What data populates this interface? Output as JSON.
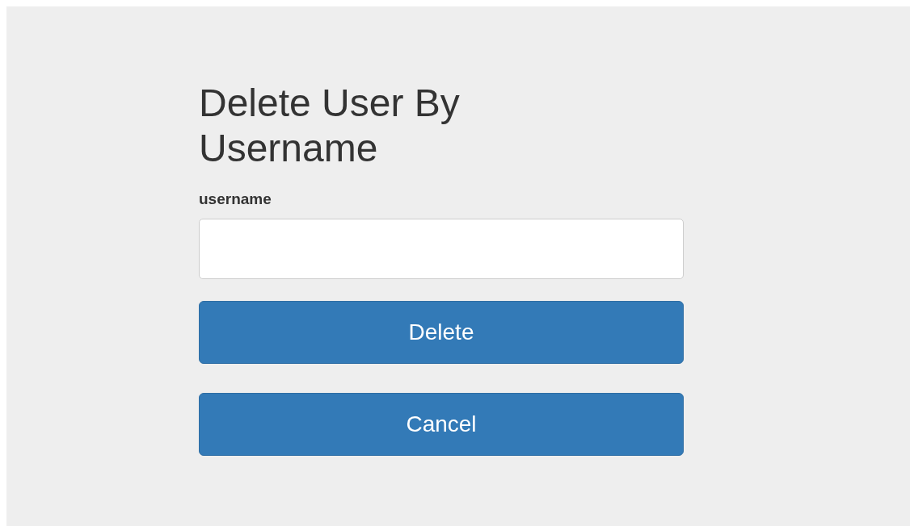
{
  "title": "Delete User By Username",
  "field": {
    "label": "username"
  },
  "buttons": [
    {
      "label": "Delete"
    },
    {
      "label": "Cancel"
    }
  ]
}
